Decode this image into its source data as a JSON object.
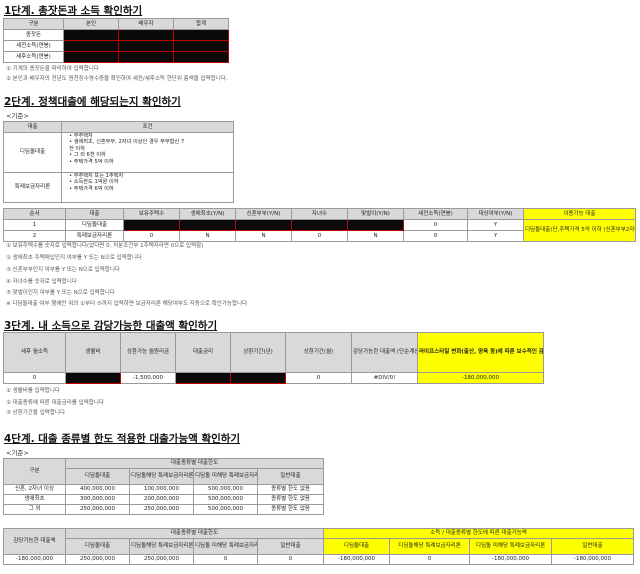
{
  "step1": {
    "title": "1단계. 총잣돈과 소득 확인하기",
    "headers": [
      "구분",
      "본인",
      "배우자",
      "합계"
    ],
    "rows": [
      "종잣돈",
      "세전소득(연봉)",
      "세후소득(연봉)"
    ],
    "notes": [
      "① 기계의 종잣돈을 파악하여 입력합니다",
      "② 본인과 배우자의 전년도 원천징수영수증을 확인하여 세전/세후소득 현단위 층액을 입력합니다."
    ]
  },
  "step2": {
    "title": "2단계. 정책대출에 해당되는지 확인하기",
    "criteria_label": "<기준>",
    "criteria_headers": [
      "대출",
      "조건"
    ],
    "criteria": [
      {
        "name": "디딤돌대출",
        "conditions": [
          "• 무주택자",
          "• 생애최초, 신혼부부, 2자녀 이상인 경우 부부합산 7",
          "  천 이하",
          "• 그 외 6천 이하",
          "• 주택가격 5억 이하"
        ]
      },
      {
        "name": "특례보금자리론",
        "conditions": [
          "• 무주택자 또는 1주택자",
          "• 소득한도 1억원 이하",
          "• 주택가격 6억 이하"
        ]
      }
    ],
    "check_headers": [
      "순서",
      "대출",
      "보유주택수",
      "생애최초(Y/N)",
      "신혼부부(Y/N)",
      "자녀수",
      "맞벌이(Y/N)",
      "세전소득(연봉)",
      "대상여부(Y/N)",
      "이용가능 대출"
    ],
    "check_rows": [
      {
        "no": "1",
        "loan": "디딤돌대출",
        "income": "0",
        "eligible": "Y"
      },
      {
        "no": "2",
        "loan": "특례보금자리론",
        "v3": "0",
        "v4": "N",
        "v5": "N",
        "v6": "0",
        "v7": "N",
        "income": "0",
        "eligible": "Y"
      }
    ],
    "available": "디딤돌대출(단,주택가격 5억 이하 (신혼부부2자녀 이상은 6억)이하)",
    "notes": [
      "① 보유주택수를 숫자로 입력합니다(없다면 0, 처분조건부 1주택자라면 0으로 입력함)",
      "② 생애최초 주택매입인지 여부를 Y 또는 N으로 입력합니다",
      "③ 신혼부부인지 여부를 Y 또는 N으로 입력합니다",
      "④ 자녀수를 숫자로 입력합니다",
      "⑤ 맞벌이인지 여부를 Y 또는 N으로 입력합니다",
      "※ 디딤돌대출 여부 행에만 위의 ①부터 ⑤까지 입력하면 보금자리론 해당여부도 자동으로 확인가능합니다"
    ]
  },
  "step3": {
    "title": "3단계. 내 소득으로 감당가능한 대출액 확인하기",
    "headers": [
      "세후 월소득",
      "생활비",
      "상환가능 월원리금",
      "대출금리",
      "상환기간(년)",
      "상환기간(월)",
      "감당가능한 대출액 (단순계산)",
      "라이프스타일 변화(출산, 양육 등)에 따른 보수적인 감당가능 대출액"
    ],
    "values": {
      "income": "0",
      "repay": "-1,500,000",
      "years": "0",
      "amount": "#DIV/0!",
      "conservative": "-180,000,000"
    },
    "notes": [
      "① 생활비를 입력합니다",
      "② 대출종류에 따른 대출금리를 입력합니다",
      "③ 상환기간을 입력합니다"
    ]
  },
  "step4": {
    "title": "4단계. 대출 종류별 한도 적용한 대출가능액 확인하기",
    "criteria_label": "<기준>",
    "group_header": "대출종류별 대출한도",
    "headers": [
      "구분",
      "디딤돌대출",
      "디딤돌해당 특례보금자리론",
      "디딤돌 미해당 특례보금자리론",
      "일반대출"
    ],
    "rows": [
      {
        "label": "신혼, 2자녀 이상",
        "v": [
          "400,000,000",
          "100,000,000",
          "500,000,000",
          "종류별 한도 없음"
        ]
      },
      {
        "label": "생애최초",
        "v": [
          "300,000,000",
          "200,000,000",
          "500,000,000",
          "종류별 한도 없음"
        ]
      },
      {
        "label": "그 외",
        "v": [
          "250,000,000",
          "250,000,000",
          "500,000,000",
          "종류별 한도 없음"
        ]
      }
    ],
    "result": {
      "left_header": "감당가능한 대출액",
      "group1": "대출종류별 대출한도",
      "group2": "소득 / 대출종류별 한도에 따른 대출가능액",
      "sub": [
        "디딤돌대출",
        "디딤돌해당 특례보금자리론",
        "디딤돌 미해당 특례보금자리론",
        "일반대출",
        "디딤돌대출",
        "디딤돌해당 특례보금자리론",
        "디딤돌 미해당 특례보금자리론",
        "일반대출"
      ],
      "values": [
        "-180,000,000",
        "250,000,000",
        "250,000,000",
        "0",
        "0",
        "-180,000,000",
        "0",
        "-180,000,000",
        "-180,000,000"
      ]
    }
  }
}
